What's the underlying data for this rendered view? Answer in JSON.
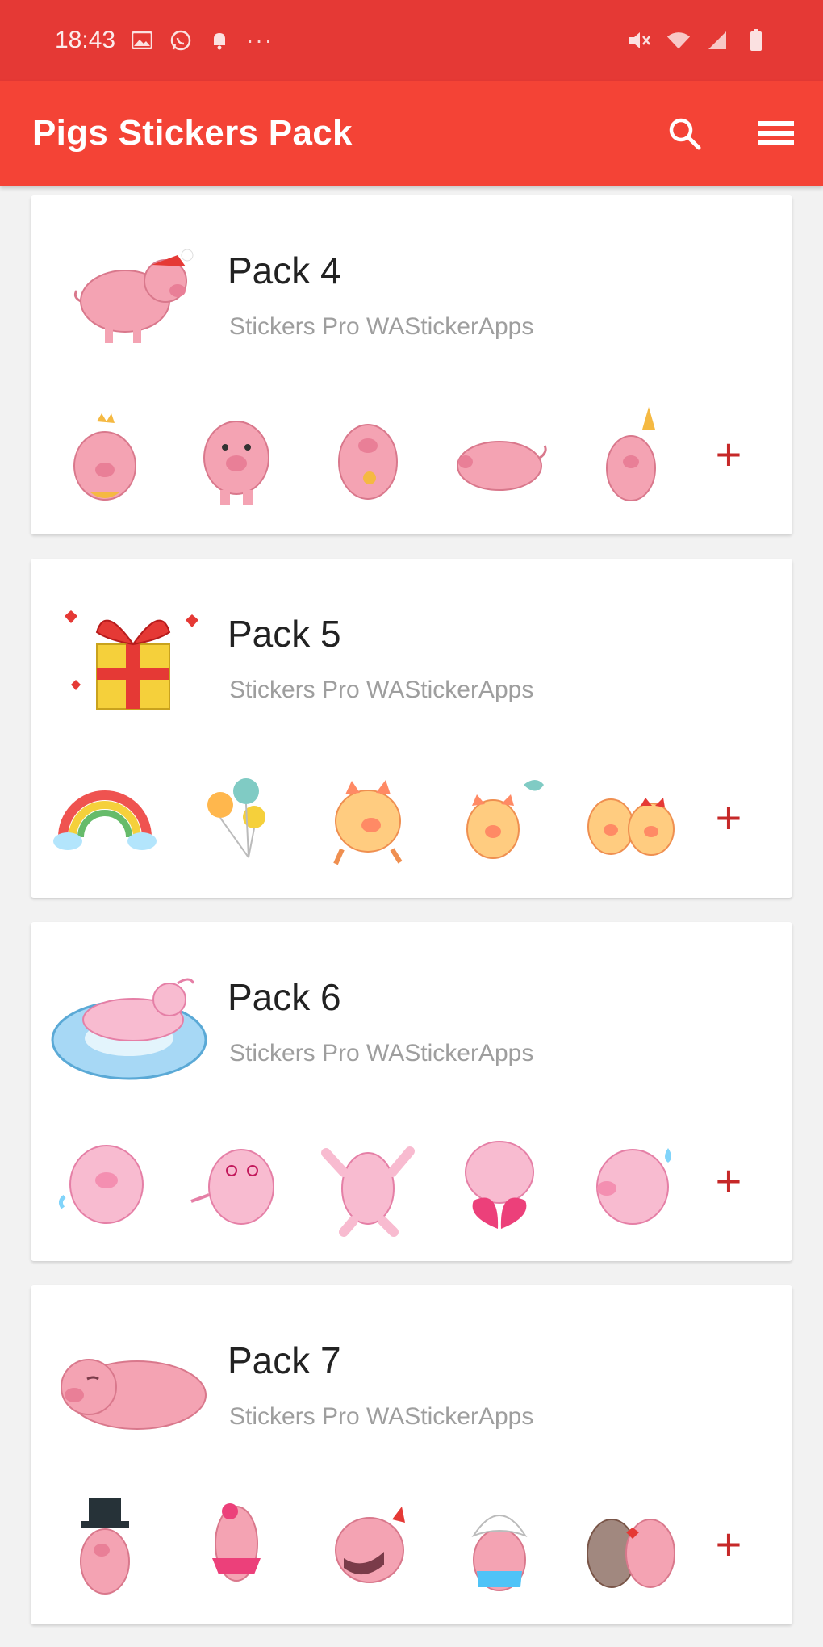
{
  "status_bar": {
    "time": "18:43",
    "left_icons": [
      "image-icon",
      "whatsapp-icon",
      "notification-icon"
    ],
    "more": "···",
    "right_icons": [
      "mute-icon",
      "wifi-icon",
      "signal-icon",
      "battery-icon"
    ]
  },
  "toolbar": {
    "title": "Pigs Stickers Pack",
    "search_icon": "search-icon",
    "menu_icon": "menu-icon"
  },
  "colors": {
    "status_bar": "#e53935",
    "toolbar": "#f44336",
    "add_plus": "#c62828",
    "pig_pink": "#f4a3b3"
  },
  "packs": [
    {
      "name": "Pack 4",
      "author": "Stickers Pro WAStickerApps",
      "tray": "pig-santa-hat-sticker",
      "stickers": [
        "pig-crown-sticker",
        "pig-standing-sticker",
        "pig-flower-sticker",
        "pig-lying-sticker",
        "pig-party-hat-sticker"
      ],
      "add_label": "+"
    },
    {
      "name": "Pack 5",
      "author": "Stickers Pro WAStickerApps",
      "tray": "gift-box-sticker",
      "stickers": [
        "rainbow-sticker",
        "balloons-sticker",
        "pig-running-sticker",
        "pig-balloon-sticker",
        "two-pigs-sticker"
      ],
      "add_label": "+"
    },
    {
      "name": "Pack 6",
      "author": "Stickers Pro WAStickerApps",
      "tray": "pig-pool-float-sticker",
      "stickers": [
        "pig-crying-sticker",
        "pig-dizzy-sticker",
        "pig-dancing-sticker",
        "pig-broken-heart-sticker",
        "pig-sweat-sticker"
      ],
      "add_label": "+"
    },
    {
      "name": "Pack 7",
      "author": "Stickers Pro WAStickerApps",
      "tray": "pig-sleeping-sticker",
      "stickers": [
        "pig-top-hat-sticker",
        "pig-tutu-sticker",
        "pig-roaring-sticker",
        "pig-bonnet-sticker",
        "pigs-kissing-sticker"
      ],
      "add_label": "+"
    }
  ]
}
